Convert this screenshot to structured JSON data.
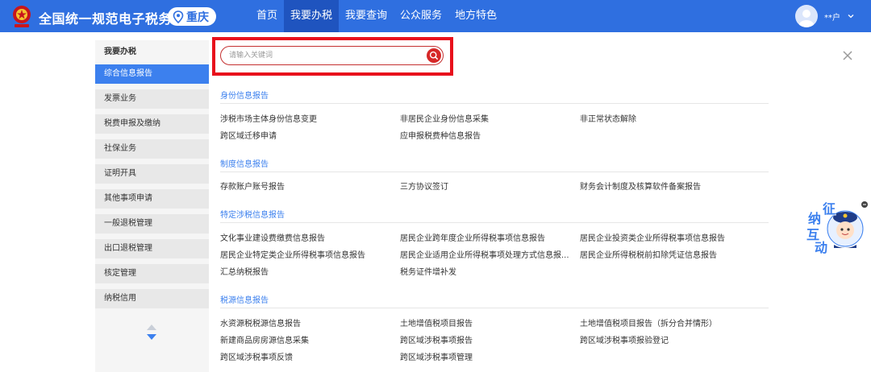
{
  "header": {
    "title": "全国统一规范电子税务局",
    "city": "重庆",
    "nav": [
      "首页",
      "我要办税",
      "我要查询",
      "公众服务",
      "地方特色"
    ],
    "active_nav": 1,
    "user_name": "**户",
    "brand_color": "#2f6fe0"
  },
  "sidebar": {
    "header": "我要办税",
    "items": [
      "综合信息报告",
      "发票业务",
      "税费申报及缴纳",
      "社保业务",
      "证明开具",
      "其他事项申请",
      "一般退税管理",
      "出口退税管理",
      "核定管理",
      "纳税信用"
    ],
    "active": 0
  },
  "search": {
    "placeholder": "请输入关键词",
    "value": ""
  },
  "sections": [
    {
      "title": "身份信息报告",
      "items": [
        "涉税市场主体身份信息变更",
        "非居民企业身份信息采集",
        "非正常状态解除",
        "跨区域迁移申请",
        "应申报税费种信息报告"
      ]
    },
    {
      "title": "制度信息报告",
      "items": [
        "存款账户账号报告",
        "三方协议签订",
        "财务会计制度及核算软件备案报告"
      ]
    },
    {
      "title": "特定涉税信息报告",
      "items": [
        "文化事业建设费缴费信息报告",
        "居民企业跨年度企业所得税事项信息报告",
        "居民企业投资类企业所得税事项信息报告",
        "居民企业特定类企业所得税事项信息报告",
        "居民企业适用企业所得税事项处理方式信息报...",
        "居民企业所得税税前扣除凭证信息报告",
        "汇总纳税报告",
        "税务证件增补发"
      ]
    },
    {
      "title": "税源信息报告",
      "items": [
        "水资源税税源信息报告",
        "土地增值税项目报告",
        "土地增值税项目报告（拆分合并情形）",
        "新建商品房房源信息采集",
        "跨区域涉税事项报告",
        "跨区域涉税事项报验登记",
        "跨区域涉税事项反馈",
        "跨区域涉税事项管理"
      ]
    }
  ],
  "mascot": {
    "text": [
      "征",
      "纳",
      "互",
      "动"
    ]
  }
}
